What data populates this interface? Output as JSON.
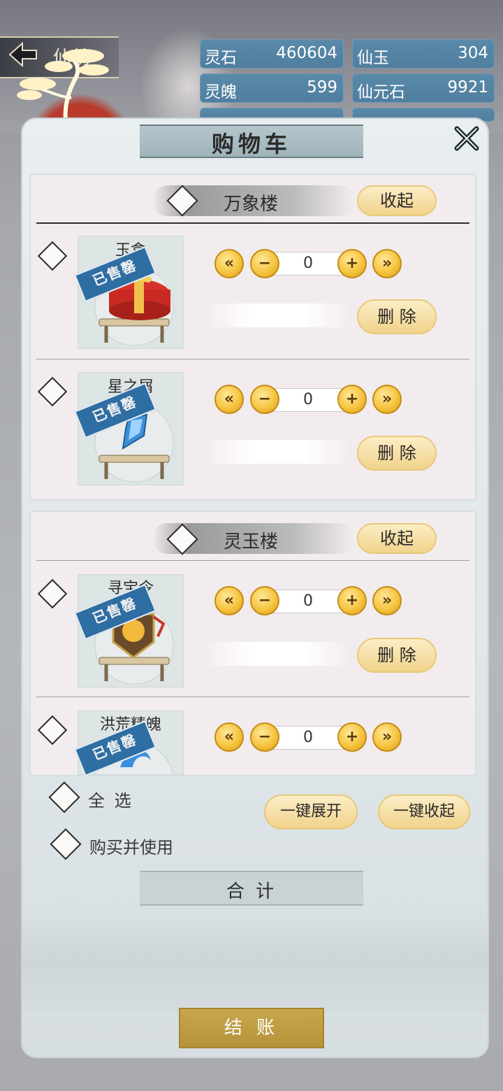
{
  "header": {
    "title": "仙坊"
  },
  "resources": [
    {
      "name": "灵石",
      "value": "460604"
    },
    {
      "name": "仙玉",
      "value": "304"
    },
    {
      "name": "灵魄",
      "value": "599"
    },
    {
      "name": "仙元石",
      "value": "9921"
    }
  ],
  "panel": {
    "title": "购物车",
    "close_icon": "close-x-icon"
  },
  "sections": [
    {
      "name": "万象楼",
      "collapse_label": "收起",
      "items": [
        {
          "name": "玉盒",
          "badge": "已售罄",
          "qty": "0",
          "delete_label": "删 除"
        },
        {
          "name": "星之屑",
          "badge": "已售罄",
          "qty": "0",
          "delete_label": "删 除"
        }
      ]
    },
    {
      "name": "灵玉楼",
      "collapse_label": "收起",
      "items": [
        {
          "name": "寻宝令",
          "badge": "已售罄",
          "qty": "0",
          "delete_label": "删 除"
        },
        {
          "name": "洪荒精魄",
          "badge": "已售罄",
          "qty": "0"
        }
      ]
    }
  ],
  "controls": {
    "min_symbol": "«",
    "minus_symbol": "−",
    "plus_symbol": "+",
    "max_symbol": "»"
  },
  "footer": {
    "select_all": "全 选",
    "buy_and_use": "购买并使用",
    "expand_all": "一键展开",
    "collapse_all": "一键收起",
    "total_label": "合 计",
    "checkout": "结 账"
  },
  "colors": {
    "accent_gold": "#f6c43f",
    "badge_blue": "#2f6ea3",
    "panel": "#e9eef0"
  }
}
